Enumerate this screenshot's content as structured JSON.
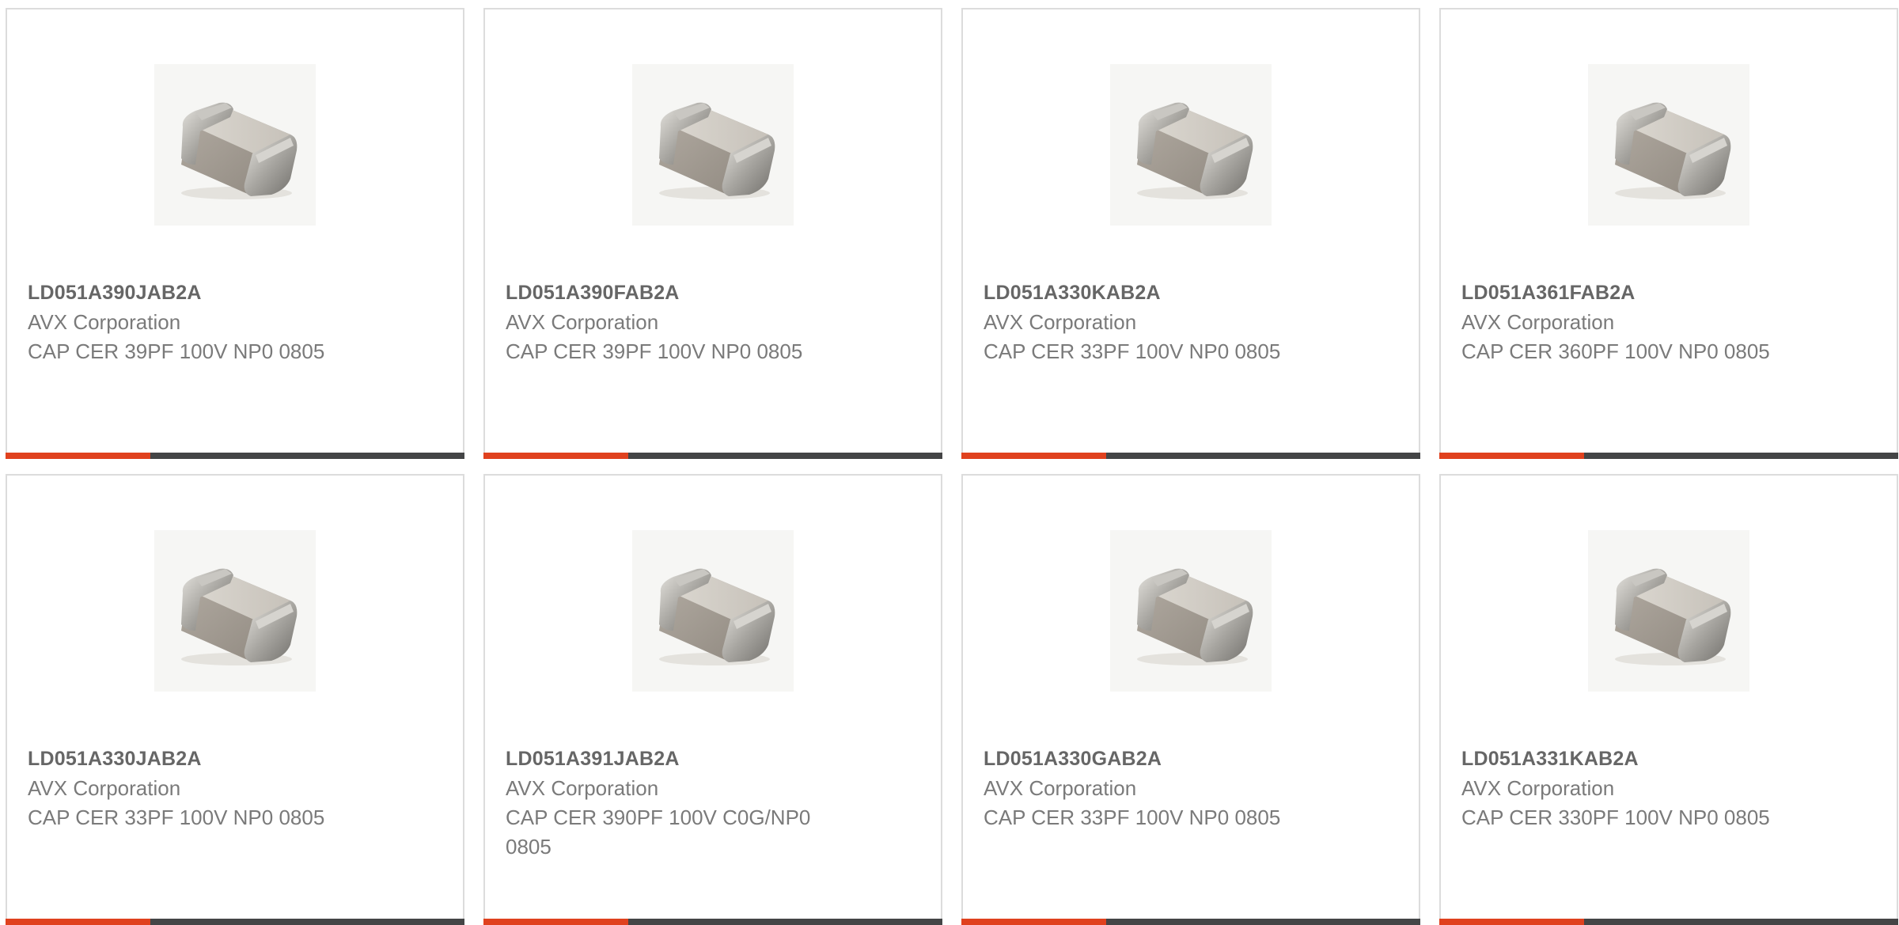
{
  "products": [
    {
      "part_number": "LD051A390JAB2A",
      "manufacturer": "AVX Corporation",
      "description": "CAP CER 39PF 100V NP0 0805",
      "image_icon": "ceramic-capacitor-chip"
    },
    {
      "part_number": "LD051A390FAB2A",
      "manufacturer": "AVX Corporation",
      "description": "CAP CER 39PF 100V NP0 0805",
      "image_icon": "ceramic-capacitor-chip"
    },
    {
      "part_number": "LD051A330KAB2A",
      "manufacturer": "AVX Corporation",
      "description": "CAP CER 33PF 100V NP0 0805",
      "image_icon": "ceramic-capacitor-chip"
    },
    {
      "part_number": "LD051A361FAB2A",
      "manufacturer": "AVX Corporation",
      "description": "CAP CER 360PF 100V NP0 0805",
      "image_icon": "ceramic-capacitor-chip"
    },
    {
      "part_number": "LD051A330JAB2A",
      "manufacturer": "AVX Corporation",
      "description": "CAP CER 33PF 100V NP0 0805",
      "image_icon": "ceramic-capacitor-chip"
    },
    {
      "part_number": "LD051A391JAB2A",
      "manufacturer": "AVX Corporation",
      "description": "CAP CER 390PF 100V C0G/NP0 0805",
      "image_icon": "ceramic-capacitor-chip"
    },
    {
      "part_number": "LD051A330GAB2A",
      "manufacturer": "AVX Corporation",
      "description": "CAP CER 33PF 100V NP0 0805",
      "image_icon": "ceramic-capacitor-chip"
    },
    {
      "part_number": "LD051A331KAB2A",
      "manufacturer": "AVX Corporation",
      "description": "CAP CER 330PF 100V NP0 0805",
      "image_icon": "ceramic-capacitor-chip"
    }
  ],
  "colors": {
    "accent": "#e0411e",
    "bar": "#444546",
    "part_text": "#666666",
    "body_text": "#7a7a7a",
    "card_border": "#dcdcdc"
  }
}
